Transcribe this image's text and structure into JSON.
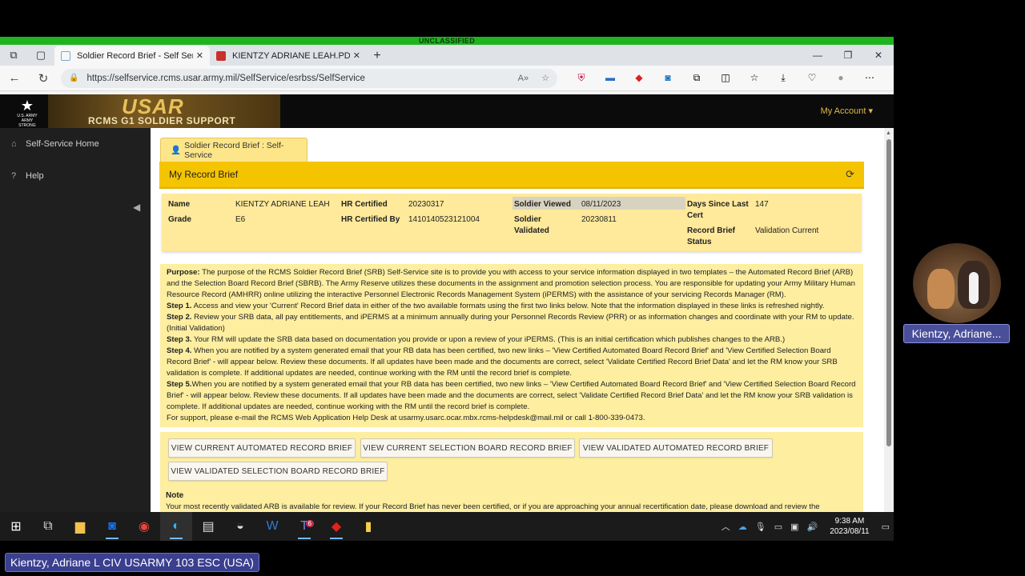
{
  "classification": "UNCLASSIFIED",
  "browser": {
    "tabs": [
      {
        "label": "Soldier Record Brief - Self Servic"
      },
      {
        "label": "KIENTZY ADRIANE LEAH.PDF"
      }
    ],
    "url": "https://selfservice.rcms.usar.army.mil/SelfService/esrbss/SelfService"
  },
  "site": {
    "logo_text": "U.S. ARMY",
    "logo_sub": "ARMY STRONG",
    "banner_title": "USAR",
    "banner_subtitle": "RCMS G1 SOLDIER SUPPORT",
    "my_account": "My Account ▾"
  },
  "sidebar": {
    "items": [
      {
        "label": "Self-Service Home"
      },
      {
        "label": "Help"
      }
    ]
  },
  "content": {
    "tab_label": "Soldier Record Brief : Self-Service",
    "panel_title": "My Record Brief",
    "fields": {
      "name_label": "Name",
      "name_value": "KIENTZY ADRIANE LEAH",
      "grade_label": "Grade",
      "grade_value": "E6",
      "hr_cert_label": "HR Certified",
      "hr_cert_value": "20230317",
      "hr_cert_by_label": "HR Certified By",
      "hr_cert_by_value": "1410140523121004",
      "soldier_viewed_label": "Soldier Viewed",
      "soldier_viewed_value": "08/11/2023",
      "soldier_validated_label_1": "Soldier",
      "soldier_validated_label_2": "Validated",
      "soldier_validated_value": "20230811",
      "days_since_label_1": "Days Since Last",
      "days_since_label_2": "Cert",
      "days_since_value": "147",
      "rb_status_label_1": "Record Brief",
      "rb_status_label_2": "Status",
      "rb_status_value": "Validation Current"
    },
    "purpose": {
      "purpose_label": "Purpose:",
      "purpose_text": "The purpose of the RCMS Soldier Record Brief (SRB) Self-Service site is to provide you with access to your service information displayed in two templates – the Automated Record Brief (ARB) and the Selection Board Record Brief (SBRB). The Army Reserve utilizes these documents in the assignment and promotion selection process. You are responsible for updating your Army Military Human Resource Record (AMHRR) online utilizing the interactive Personnel Electronic Records Management System (iPERMS) with the assistance of your servicing Records Manager (RM).",
      "step1_label": "Step 1.",
      "step1_text": "Access and view your 'Current' Record Brief data in either of the two available formats using the first two links below. Note that the information displayed in these links is refreshed nightly.",
      "step2_label": "Step 2.",
      "step2_text": "Review your SRB data, all pay entitlements, and iPERMS at a minimum annually during your Personnel Records Review (PRR) or as information changes and coordinate with your RM to update. (Initial Validation)",
      "step3_label": "Step 3.",
      "step3_text": "Your RM will update the SRB data based on documentation you provide or upon a review of your iPERMS. (This is an initial certification which publishes changes to the ARB.)",
      "step4_label": "Step 4.",
      "step4_text": "When you are notified by a system generated email that your RB data has been certified, two new links – 'View Certified Automated Board Record Brief' and 'View Certified Selection Board Record Brief' - will appear below. Review these documents. If all updates have been made and the documents are correct, select 'Validate Certified Record Brief Data' and let the RM know your SRB validation is complete. If additional updates are needed, continue working with the RM until the record brief is complete.",
      "step5_label": "Step 5.",
      "step5_text": "When you are notified by a system generated email that your RB data has been certified, two new links – 'View Certified Automated Board Record Brief' and 'View Certified Selection Board Record Brief' - will appear below. Review these documents. If all updates have been made and the documents are correct, select 'Validate Certified Record Brief Data' and let the RM know your SRB validation is complete. If additional updates are needed, continue working with the RM until the record brief is complete.",
      "support_text": "For support, please e-mail the RCMS Web Application Help Desk at usarmy.usarc.ocar.mbx.rcms-helpdesk@mail.mil or call 1-800-339-0473."
    },
    "buttons": {
      "b1": "VIEW CURRENT AUTOMATED RECORD BRIEF",
      "b2": "VIEW CURRENT SELECTION BOARD RECORD BRIEF",
      "b3": "VIEW VALIDATED AUTOMATED RECORD BRIEF",
      "b4": "VIEW VALIDATED SELECTION BOARD RECORD BRIEF"
    },
    "note_title": "Note",
    "note_text": "Your most recently validated ARB is available for review. If your Record Brief has never been certified, or if you are approaching your annual recertification date, please download and review the"
  },
  "taskbar": {
    "time": "9:38 AM",
    "date": "2023/08/11",
    "teams_badge": "6"
  },
  "meeting": {
    "participant_name": "Kientzy, Adriane...",
    "presenter_name": "Kientzy, Adriane L CIV USARMY 103 ESC (USA)"
  }
}
